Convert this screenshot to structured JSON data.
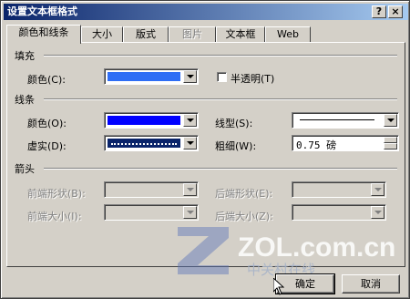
{
  "window": {
    "title": "设置文本框格式"
  },
  "titlebar": {
    "help": "?",
    "close": "×"
  },
  "tabs": [
    {
      "label": "颜色和线条",
      "state": "active"
    },
    {
      "label": "大小",
      "state": "normal"
    },
    {
      "label": "版式",
      "state": "normal"
    },
    {
      "label": "图片",
      "state": "disabled"
    },
    {
      "label": "文本框",
      "state": "normal"
    },
    {
      "label": "Web",
      "state": "normal"
    }
  ],
  "fill": {
    "section": "填充",
    "color_label": "颜色(C):",
    "color_value": "#2f6ef5",
    "semi_transparent_label": "半透明(T)"
  },
  "line": {
    "section": "线条",
    "color_label": "颜色(O):",
    "color_value": "#0000ff",
    "dash_label": "虚实(D):",
    "style_label": "线型(S):",
    "weight_label": "粗细(W):",
    "weight_value": "0.75 磅"
  },
  "arrows": {
    "section": "箭头",
    "begin_style_label": "前端形状(B):",
    "begin_size_label": "前端大小(I):",
    "end_style_label": "后端形状(E):",
    "end_size_label": "后端大小(Z):"
  },
  "buttons": {
    "ok": "确定",
    "cancel": "取消"
  },
  "watermark": {
    "brand": "ZOL.com.cn",
    "cn": "中关村在线"
  }
}
